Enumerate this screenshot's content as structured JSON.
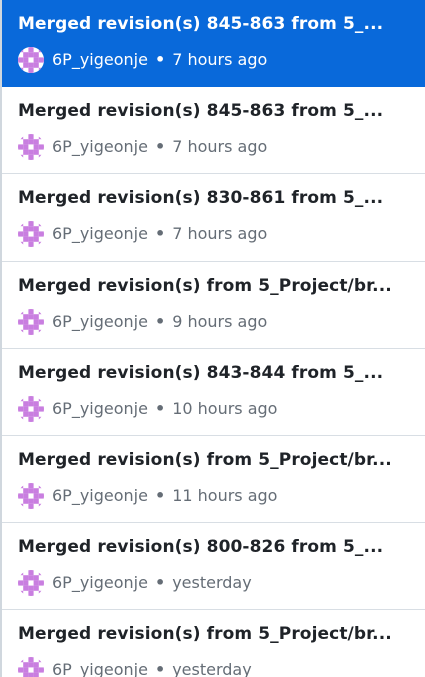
{
  "colors": {
    "selected_bg": "#0969da",
    "avatar_accent": "#c97ee0",
    "meta_text": "#656d76",
    "title_text": "#1f2328"
  },
  "commits": {
    "items": [
      {
        "title": "Merged revision(s) 845-863 from 5_...",
        "author": "6P_yigeonje",
        "sep": "•",
        "time": "7 hours ago",
        "selected": true,
        "avatar_icon": "identicon-avatar"
      },
      {
        "title": "Merged revision(s) 845-863 from 5_...",
        "author": "6P_yigeonje",
        "sep": "•",
        "time": "7 hours ago",
        "selected": false,
        "avatar_icon": "identicon-avatar"
      },
      {
        "title": "Merged revision(s) 830-861 from 5_...",
        "author": "6P_yigeonje",
        "sep": "•",
        "time": "7 hours ago",
        "selected": false,
        "avatar_icon": "identicon-avatar"
      },
      {
        "title": "Merged revision(s) from 5_Project/br...",
        "author": "6P_yigeonje",
        "sep": "•",
        "time": "9 hours ago",
        "selected": false,
        "avatar_icon": "identicon-avatar"
      },
      {
        "title": "Merged revision(s) 843-844 from 5_...",
        "author": "6P_yigeonje",
        "sep": "•",
        "time": "10 hours ago",
        "selected": false,
        "avatar_icon": "identicon-avatar"
      },
      {
        "title": "Merged revision(s) from 5_Project/br...",
        "author": "6P_yigeonje",
        "sep": "•",
        "time": "11 hours ago",
        "selected": false,
        "avatar_icon": "identicon-avatar"
      },
      {
        "title": "Merged revision(s) 800-826 from 5_...",
        "author": "6P_yigeonje",
        "sep": "•",
        "time": "yesterday",
        "selected": false,
        "avatar_icon": "identicon-avatar"
      },
      {
        "title": "Merged revision(s) from 5_Project/br...",
        "author": "6P_yigeonje",
        "sep": "•",
        "time": "yesterday",
        "selected": false,
        "avatar_icon": "identicon-avatar"
      }
    ]
  }
}
